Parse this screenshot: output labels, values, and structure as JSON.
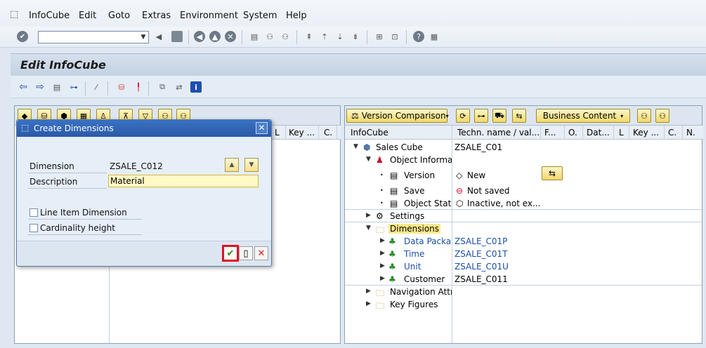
{
  "menu": {
    "items": [
      {
        "first": "I",
        "rest": "nfoCube"
      },
      {
        "first": "E",
        "rest": "dit"
      },
      {
        "first": "G",
        "rest": "oto"
      },
      {
        "first": "",
        "rest": "Extras",
        "u": "s"
      },
      {
        "first": "",
        "rest": "Environment"
      },
      {
        "first": "S",
        "rest": "ystem"
      },
      {
        "first": "H",
        "rest": "elp"
      }
    ],
    "labels": [
      "InfoCube",
      "Edit",
      "Goto",
      "Extras",
      "Environment",
      "System",
      "Help"
    ]
  },
  "page": {
    "title": "Edit InfoCube"
  },
  "left_pane": {
    "columns": [
      "L",
      "Key ...",
      "C."
    ]
  },
  "dialog": {
    "title": "Create Dimensions",
    "dimension_label": "Dimension",
    "dimension_value": "ZSALE_C012",
    "description_label": "Description",
    "description_value": "Material",
    "line_item_label": "Line Item Dimension",
    "cardinality_label": "Cardinality height"
  },
  "right_pane": {
    "version_comparison": "Version Comparison",
    "business_content": "Business Content",
    "columns": [
      "InfoCube",
      "Techn. name / val...",
      "F...",
      "O.",
      "Dat...",
      "L",
      "Key ...",
      "C.",
      "N."
    ],
    "rows": [
      {
        "label": "Sales Cube",
        "value": "ZSALE_C01",
        "blue": false
      },
      {
        "label": "Object Informat",
        "value": "",
        "blue": false
      },
      {
        "label": "Version",
        "value": "New",
        "blue": false
      },
      {
        "label": "Save",
        "value": "Not saved",
        "blue": false
      },
      {
        "label": "Object Statu",
        "value": "Inactive, not ex...",
        "blue": false
      },
      {
        "label": "Settings",
        "value": "",
        "blue": false
      },
      {
        "label": "Dimensions",
        "value": "",
        "blue": false
      },
      {
        "label": "Data Packag",
        "value": "ZSALE_C01P",
        "blue": true
      },
      {
        "label": "Time",
        "value": "ZSALE_C01T",
        "blue": true
      },
      {
        "label": "Unit",
        "value": "ZSALE_C01U",
        "blue": true
      },
      {
        "label": "Customer",
        "value": "ZSALE_C011",
        "blue": false
      },
      {
        "label": "Navigation Attrib",
        "value": "",
        "blue": false
      },
      {
        "label": "Key Figures",
        "value": "",
        "blue": false
      }
    ]
  },
  "colors": {
    "dialog_title": "#2a5aa8",
    "highlight": "#fce98a",
    "confirm_border": "#e0102a"
  }
}
